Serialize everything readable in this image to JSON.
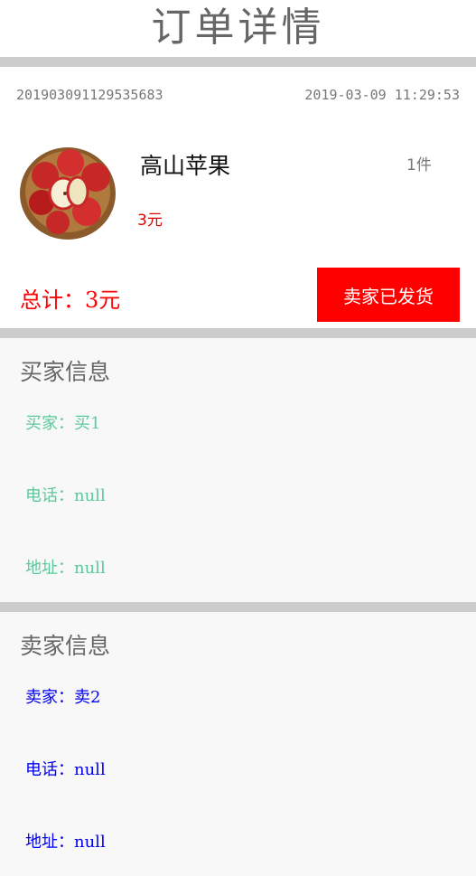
{
  "header": {
    "title": "订单详情"
  },
  "order": {
    "order_number": "20190309112953568З",
    "datetime": "2019-03-09  11:29:53",
    "product_name": "高山苹果",
    "quantity": "1件",
    "price": "3元",
    "total": "总计：3元",
    "status_button": "卖家已发货"
  },
  "buyer": {
    "title": "买家信息",
    "name": "买家：买1",
    "phone": "电话：null",
    "address": "地址：null"
  },
  "seller": {
    "title": "卖家信息",
    "name": "卖家：卖2",
    "phone": "电话：null",
    "address": "地址：null"
  },
  "colors": {
    "divider": "#cccccc",
    "accent_red": "#ff0000",
    "buyer_text": "#5cc99a",
    "seller_text": "#0000ee"
  }
}
